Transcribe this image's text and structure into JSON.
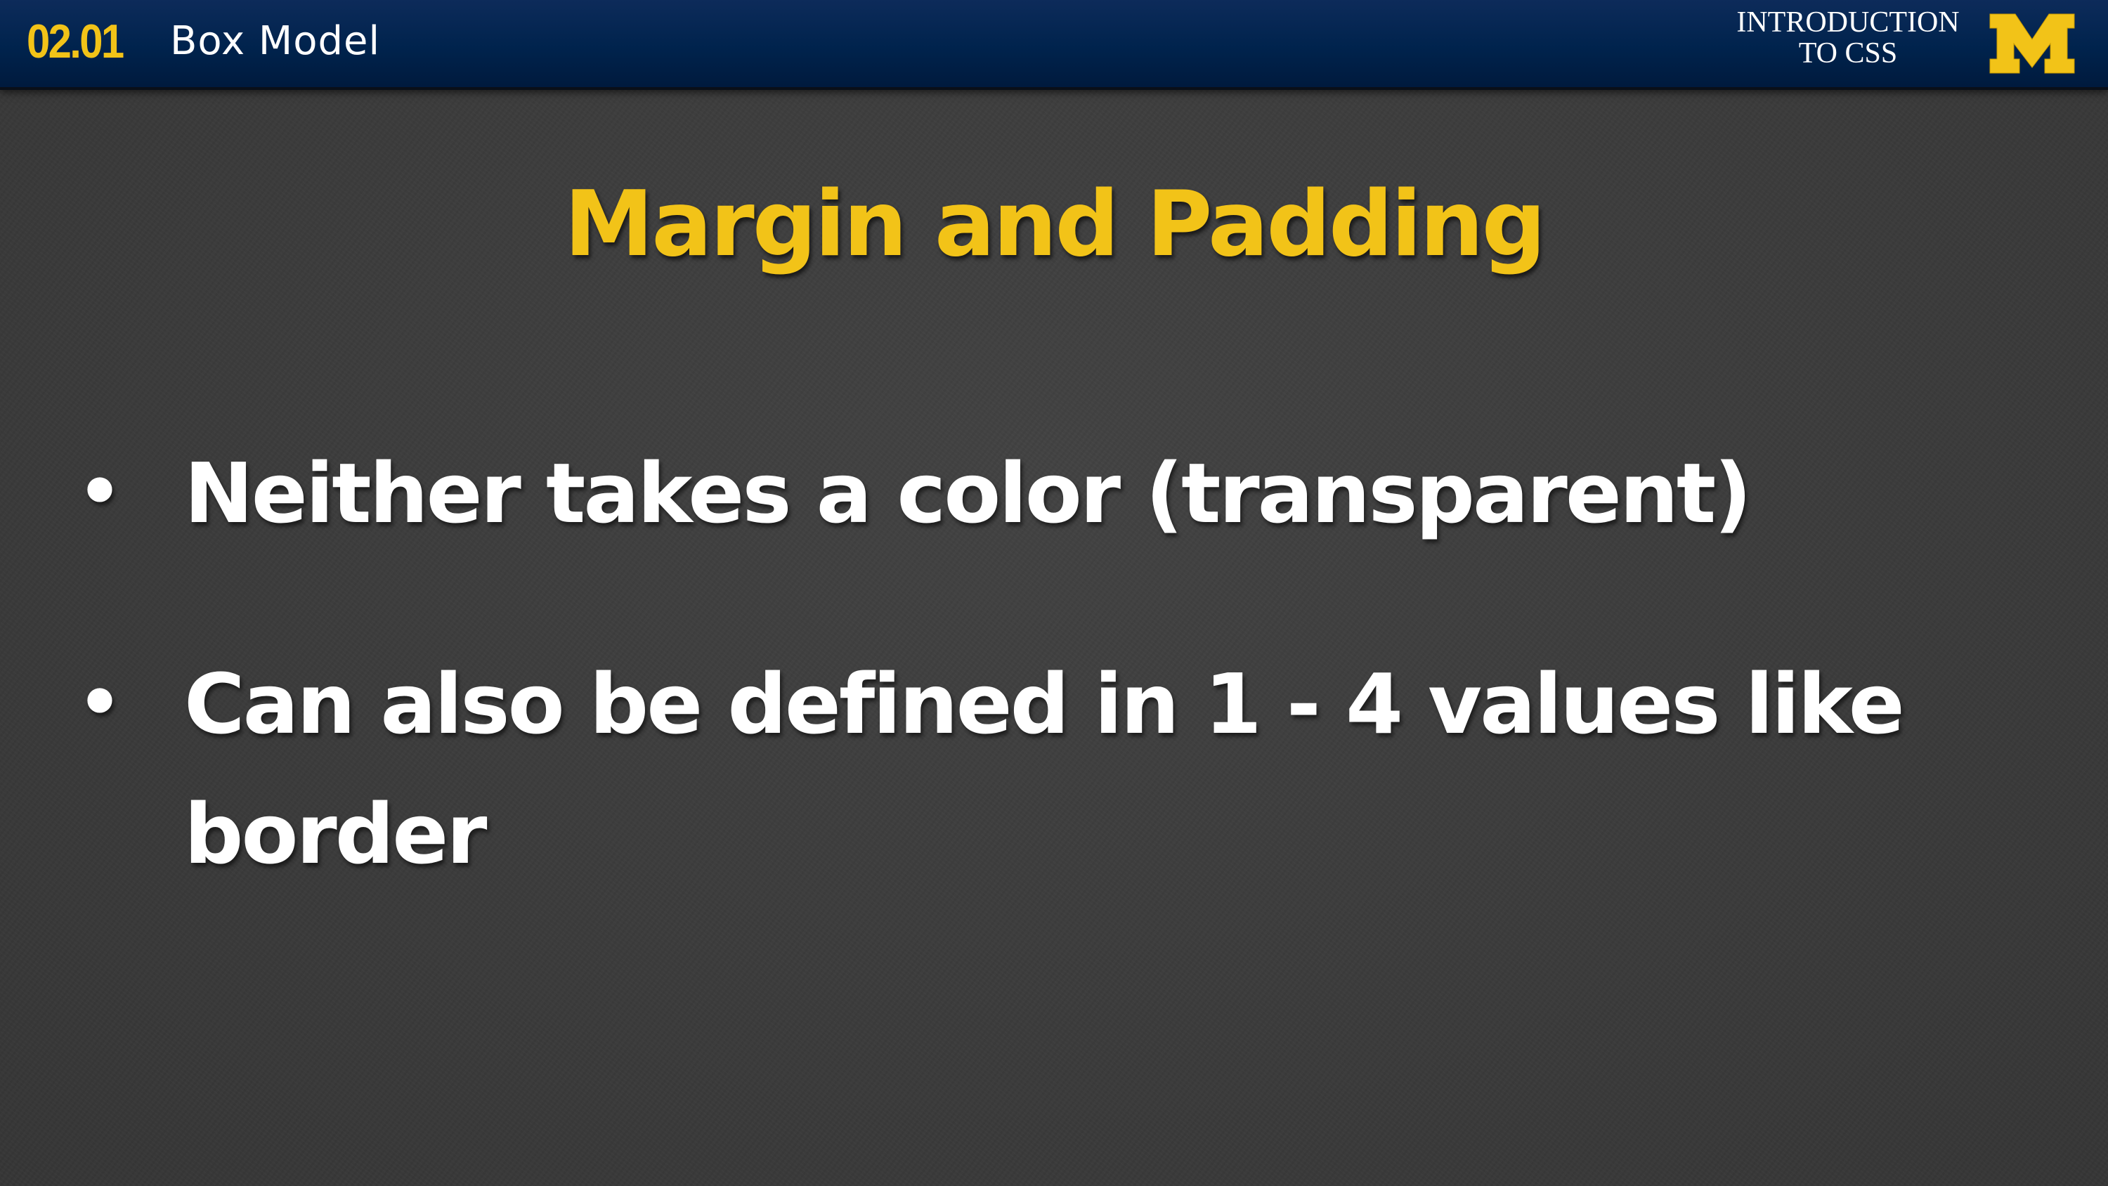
{
  "header": {
    "section_number": "02.01",
    "section_title": "Box Model",
    "course_title_line1": "INTRODUCTION",
    "course_title_line2": "TO CSS",
    "logo_icon": "university-block-m-logo",
    "logo_color": "#f2c318"
  },
  "slide": {
    "title": "Margin and Padding",
    "bullet_symbol": "•",
    "bullets": [
      "Neither takes a color (transparent)",
      "Can also be defined in 1 - 4 values like border"
    ]
  },
  "colors": {
    "accent": "#f2c318",
    "header_bg": "#00234d",
    "slide_bg": "#3c3c3c",
    "text": "#ffffff"
  }
}
